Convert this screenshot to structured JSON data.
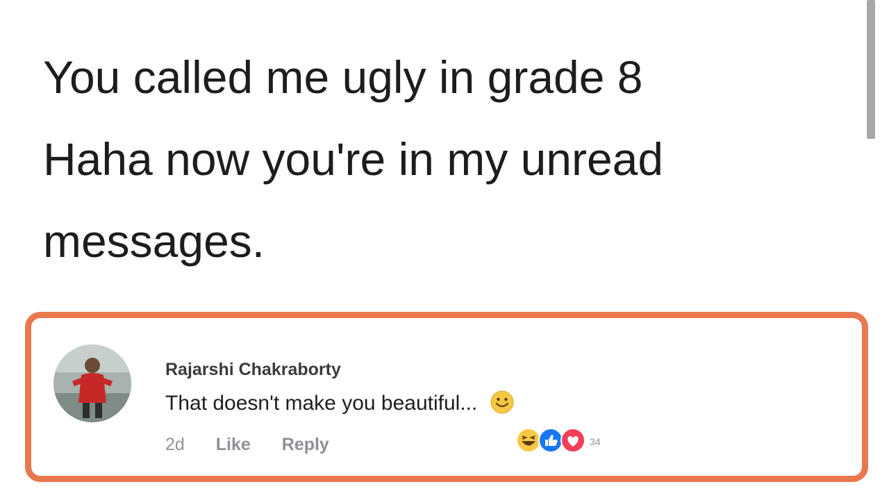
{
  "post": {
    "lines": [
      "You called me ugly in grade 8",
      "Haha now you're in my unread",
      "messages."
    ]
  },
  "comment": {
    "author": "Rajarshi Chakraborty",
    "text": "That doesn't make you beautiful...",
    "time": "2d",
    "like_label": "Like",
    "reply_label": "Reply",
    "reaction_count": "34",
    "reactions": [
      "laugh-reaction-icon",
      "like-reaction-icon",
      "love-reaction-icon"
    ]
  },
  "colors": {
    "highlight_border": "#e9784f",
    "like_blue": "#1877f2",
    "love_red": "#f33e58",
    "emoji_yellow": "#f7c844"
  }
}
